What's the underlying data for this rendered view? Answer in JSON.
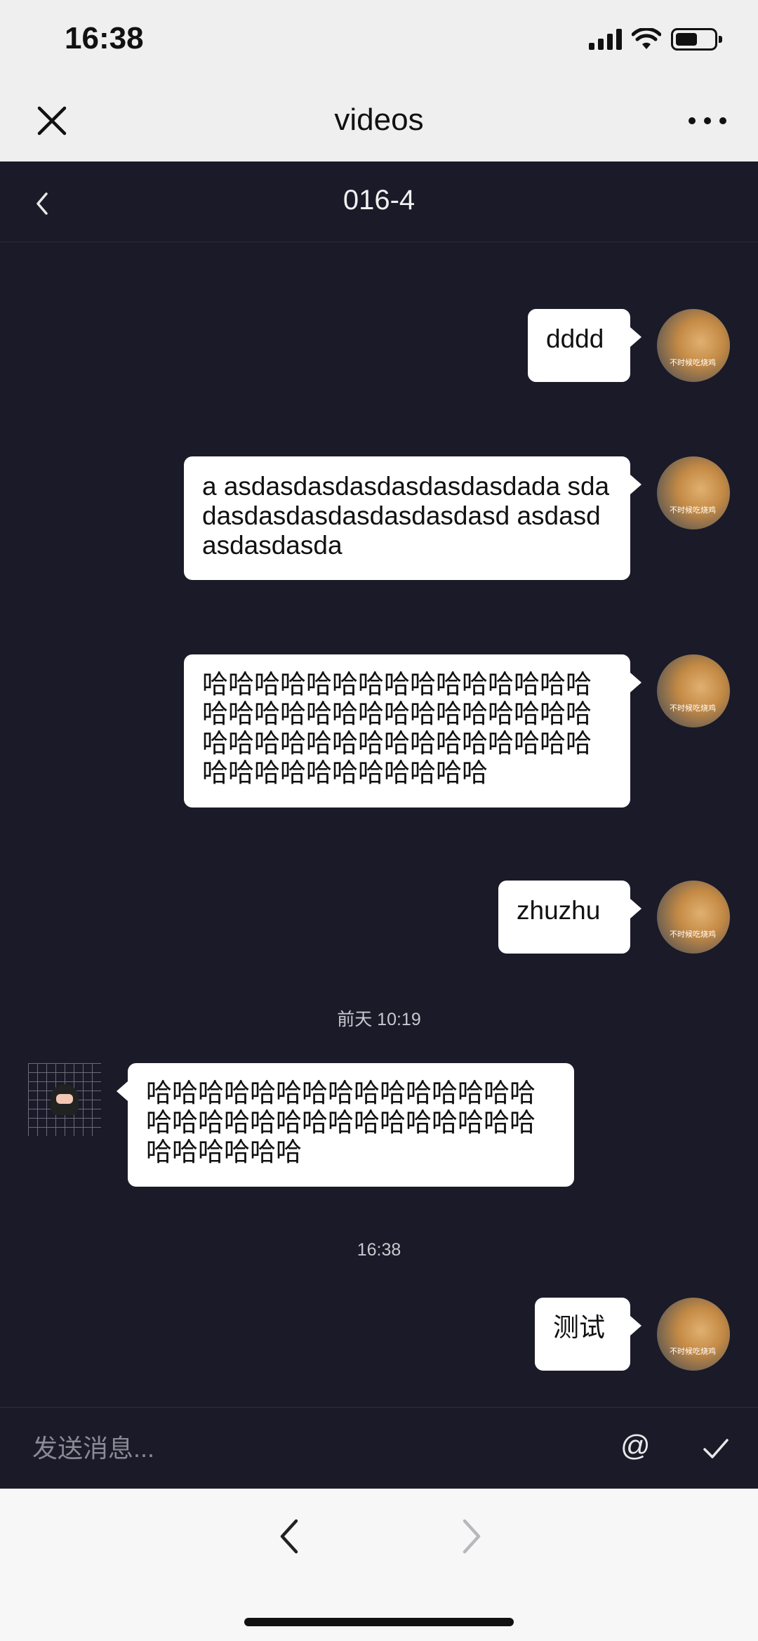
{
  "status": {
    "time": "16:38"
  },
  "browser": {
    "title": "videos"
  },
  "chat": {
    "title": "016-4",
    "messages": [
      {
        "side": "right",
        "text": "dddd"
      },
      {
        "side": "right",
        "text": "a asdasdasdasdasdasdasdada sdadasdasdasdasdasdasdasd asdasdasdasdasda"
      },
      {
        "side": "right",
        "text": "哈哈哈哈哈哈哈哈哈哈哈哈哈哈哈哈哈哈哈哈哈哈哈哈哈哈哈哈哈哈哈哈哈哈哈哈哈哈哈哈哈哈哈哈哈哈哈哈哈哈哈哈哈哈哈哈"
      },
      {
        "side": "right",
        "text": "zhuzhu"
      },
      {
        "side": "left",
        "text": "哈哈哈哈哈哈哈哈哈哈哈哈哈哈哈哈哈哈哈哈哈哈哈哈哈哈哈哈哈哈哈哈哈哈哈哈"
      },
      {
        "side": "right",
        "text": "测试"
      }
    ],
    "timestamps": [
      "前天 10:19",
      "16:38"
    ],
    "avatar_caption": "不时候吃烧鸡"
  },
  "input": {
    "placeholder": "发送消息...",
    "at_label": "@"
  },
  "icons": {
    "close": "close-icon",
    "more": "more-icon",
    "back": "back-icon",
    "send": "check-icon",
    "nav_back": "chevron-left-icon",
    "nav_forward": "chevron-right-icon"
  }
}
